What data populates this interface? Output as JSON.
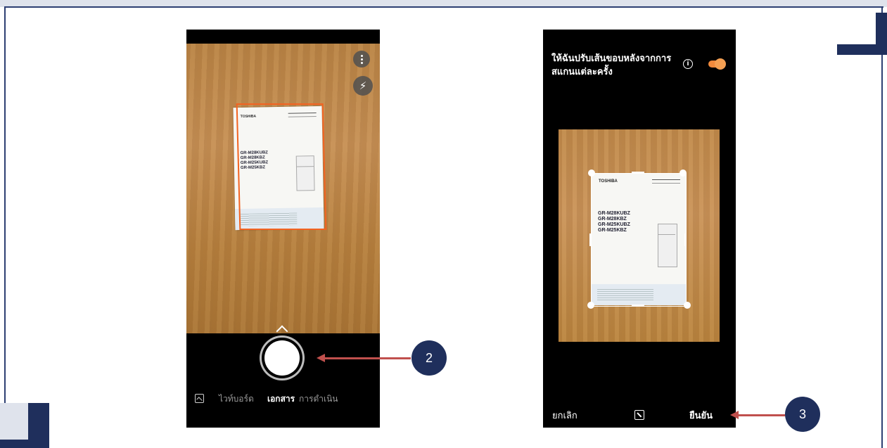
{
  "phone1": {
    "document": {
      "brand": "TOSHIBA",
      "models": [
        "GR-M28KUBZ",
        "GR-M28KBZ",
        "GR-M25KUBZ",
        "GR-M25KBZ"
      ]
    },
    "modes": {
      "whiteboard": "ไวท์บอร์ด",
      "document": "เอกสาร",
      "actions": "การดำเนิน"
    }
  },
  "phone2": {
    "title": "ให้ฉันปรับเส้นขอบหลังจากการสแกนแต่ละครั้ง",
    "info_glyph": "i",
    "toggle_on": true,
    "toggle_color": "#f28a3c",
    "document": {
      "brand": "TOSHIBA",
      "models": [
        "GR-M28KUBZ",
        "GR-M28KBZ",
        "GR-M25KUBZ",
        "GR-M25KBZ"
      ]
    },
    "cancel_label": "ยกเลิก",
    "confirm_label": "ยืนยัน"
  },
  "callouts": {
    "step_2": "2",
    "step_3": "3",
    "badge_color": "#1f2f5c",
    "arrow_color": "#c0504d"
  },
  "icons": {
    "more": "more-vertical-icon",
    "flash": "flash-auto-icon",
    "gallery": "gallery-icon",
    "crop": "crop-icon",
    "info": "info-icon"
  }
}
